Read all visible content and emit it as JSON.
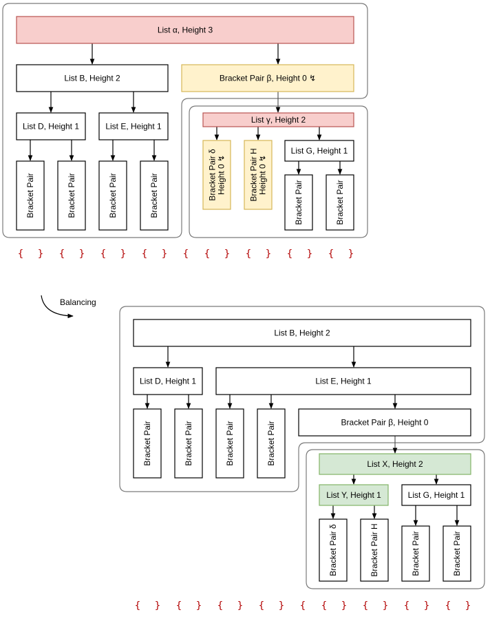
{
  "colors": {
    "red_fill": "#f8cecc",
    "red_stroke": "#b85450",
    "yellow_fill": "#fff2cc",
    "yellow_stroke": "#d6b656",
    "green_fill": "#d5e8d4",
    "green_stroke": "#82b366",
    "plain_fill": "#ffffff",
    "plain_stroke": "#000000",
    "brace_color": "#b20000"
  },
  "before": {
    "nodes": {
      "alpha": "List α, Height 3",
      "B": "List B, Height 2",
      "beta": "Bracket Pair β, Height 0 ↯",
      "D": "List D, Height 1",
      "E": "List E, Height 1",
      "gamma": "List γ, Height 2",
      "delta": [
        "Bracket Pair δ",
        "Height 0 ↯"
      ],
      "H": [
        "Bracket Pair H",
        "Height 0 ↯"
      ],
      "G": "List G, Height 1",
      "leaf": "Bracket Pair"
    },
    "braces": [
      "{",
      "}",
      "{",
      "}",
      "{",
      "}",
      "{",
      "}",
      "{",
      "{",
      "}",
      "{",
      "}",
      "{",
      "}",
      "{",
      "}"
    ]
  },
  "transition_label": "Balancing",
  "after": {
    "nodes": {
      "B": "List B, Height 2",
      "D": "List D, Height 1",
      "E": "List E, Height 1",
      "beta": "Bracket Pair β, Height 0",
      "X": "List X, Height 2",
      "Y": "List Y, Height 1",
      "G": "List G, Height 1",
      "delta": "Bracket Pair δ",
      "H": "Bracket Pair H",
      "leaf": "Bracket Pair"
    },
    "braces": [
      "{",
      "}",
      "{",
      "}",
      "{",
      "}",
      "{",
      "}",
      "{",
      "{",
      "}",
      "{",
      "}",
      "{",
      "}",
      "{",
      "}"
    ]
  }
}
